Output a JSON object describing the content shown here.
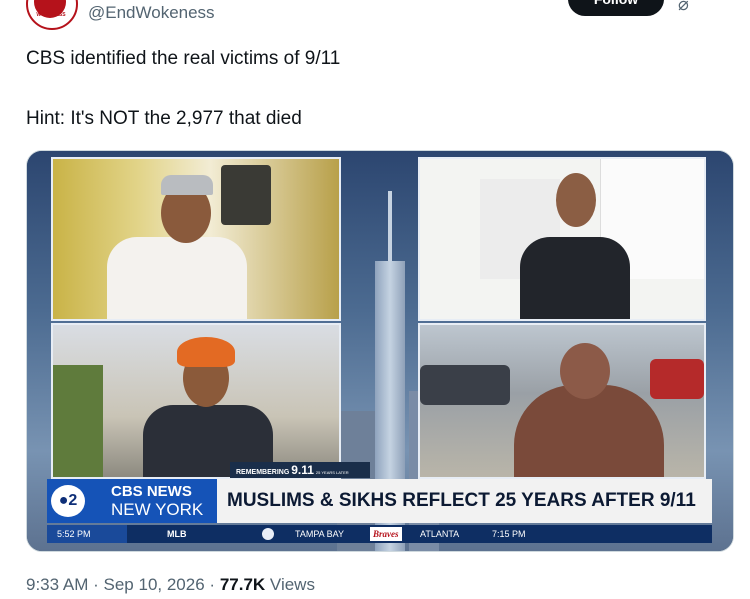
{
  "author": {
    "handle": "@EndWokeness",
    "avatar_text": "WOKENESS",
    "follow_label": "Follow"
  },
  "tweet": {
    "line1": "CBS identified the real victims of 9/11",
    "line2": "Hint: It's NOT the 2,977 that died"
  },
  "media": {
    "remembering_label": "REMEMBERING",
    "remembering_num": "9.11",
    "remembering_sub": "25 YEARS LATER",
    "logo_text": "●2",
    "network_line1": "CBS NEWS",
    "network_line2": "NEW YORK",
    "headline": "MUSLIMS & SIKHS REFLECT 25 YEARS AFTER 9/11",
    "ticker": {
      "time": "5:52 PM",
      "league": "MLB",
      "team1": "TAMPA BAY",
      "team2_logo": "Braves",
      "team2": "ATLANTA",
      "game_time": "7:15 PM"
    }
  },
  "footer": {
    "time": "9:33 AM",
    "date": "Sep 10, 2026",
    "views_count": "77.7K",
    "views_label": "Views",
    "sep": "·"
  },
  "colors": {
    "brand_blue": "#1553b7",
    "ticker_bg": "#0e2e63",
    "text": "#0f1419",
    "muted": "#536471"
  }
}
